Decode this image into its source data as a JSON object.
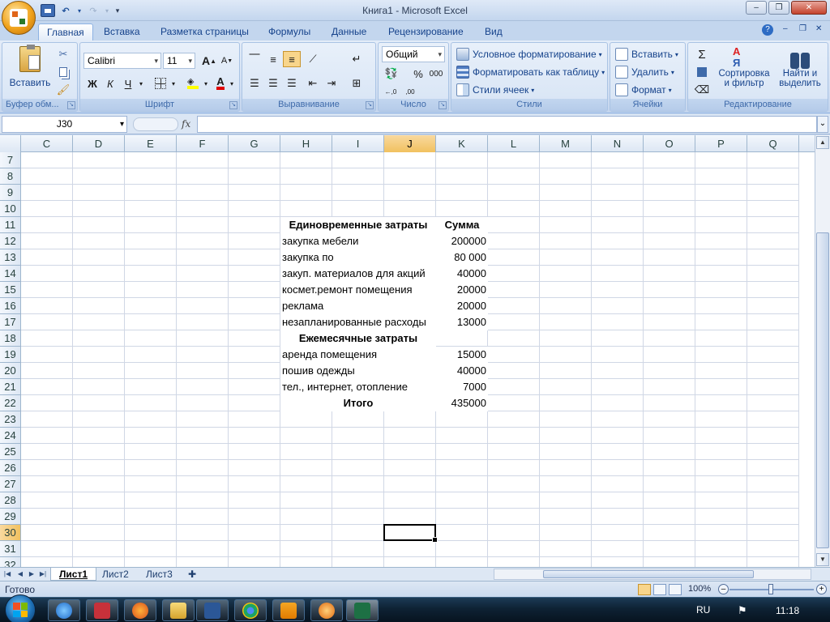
{
  "window": {
    "title": "Книга1 - Microsoft Excel",
    "minimize": "–",
    "restore": "❐",
    "close": "✕"
  },
  "ribbon": {
    "tabs": [
      "Главная",
      "Вставка",
      "Разметка страницы",
      "Формулы",
      "Данные",
      "Рецензирование",
      "Вид"
    ],
    "active_tab": "Главная",
    "help": "?",
    "clipboard": {
      "label": "Буфер обм...",
      "paste": "Вставить"
    },
    "font": {
      "label": "Шрифт",
      "name": "Calibri",
      "size": "11",
      "bold": "Ж",
      "italic": "К",
      "underline": "Ч",
      "grow": "A",
      "shrink": "A"
    },
    "alignment": {
      "label": "Выравнивание"
    },
    "number": {
      "label": "Число",
      "format": "Общий",
      "percent": "%",
      "thousands": "000"
    },
    "styles": {
      "label": "Стили",
      "conditional": "Условное форматирование",
      "as_table": "Форматировать как таблицу",
      "cell_styles": "Стили ячеек"
    },
    "cells": {
      "label": "Ячейки",
      "insert": "Вставить",
      "delete": "Удалить",
      "format": "Формат"
    },
    "editing": {
      "label": "Редактирование",
      "sort_line1": "Сортировка",
      "sort_line2": "и фильтр",
      "find_line1": "Найти и",
      "find_line2": "выделить",
      "sigma": "Σ"
    }
  },
  "formula_bar": {
    "name_box": "J30",
    "fx": "fx",
    "formula": ""
  },
  "columns": [
    "C",
    "D",
    "E",
    "F",
    "G",
    "H",
    "I",
    "J",
    "K",
    "L",
    "M",
    "N",
    "O",
    "P",
    "Q"
  ],
  "selected_column": "J",
  "rows": [
    "7",
    "8",
    "9",
    "10",
    "11",
    "12",
    "13",
    "14",
    "15",
    "16",
    "17",
    "18",
    "19",
    "20",
    "21",
    "22",
    "23",
    "24",
    "25",
    "26",
    "27",
    "28",
    "29",
    "30",
    "31",
    "32"
  ],
  "selected_row": "30",
  "cells": [
    {
      "row": "11",
      "label": "Единовременные затраты",
      "value": "Сумма",
      "style": "header"
    },
    {
      "row": "12",
      "label": "закупка мебели",
      "value": "200000"
    },
    {
      "row": "13",
      "label": "закупка по",
      "value": "80 000"
    },
    {
      "row": "14",
      "label": "закуп. материалов для акций",
      "value": "40000"
    },
    {
      "row": "15",
      "label": "космет.ремонт помещения",
      "value": "20000"
    },
    {
      "row": "16",
      "label": "реклама",
      "value": "20000"
    },
    {
      "row": "17",
      "label": "незапланированные расходы",
      "value": "13000"
    },
    {
      "row": "18",
      "label": "Ежемесячные затраты",
      "value": "",
      "style": "section"
    },
    {
      "row": "19",
      "label": "аренда помещения",
      "value": "15000"
    },
    {
      "row": "20",
      "label": "пошив одежды",
      "value": "40000"
    },
    {
      "row": "21",
      "label": "тел., интернет, отопление",
      "value": "7000"
    },
    {
      "row": "22",
      "label": "Итого",
      "value": "435000",
      "style": "total"
    }
  ],
  "sheets": [
    "Лист1",
    "Лист2",
    "Лист3"
  ],
  "active_sheet": "Лист1",
  "status": {
    "text": "Готово",
    "zoom": "100%",
    "zoom_minus": "–",
    "zoom_plus": "+"
  },
  "taskbar": {
    "lang": "RU",
    "time": "11:18"
  },
  "colors": {
    "ribbon_text": "#15428b",
    "selection": "#f1c15f",
    "gridline": "#d0d7e5"
  }
}
